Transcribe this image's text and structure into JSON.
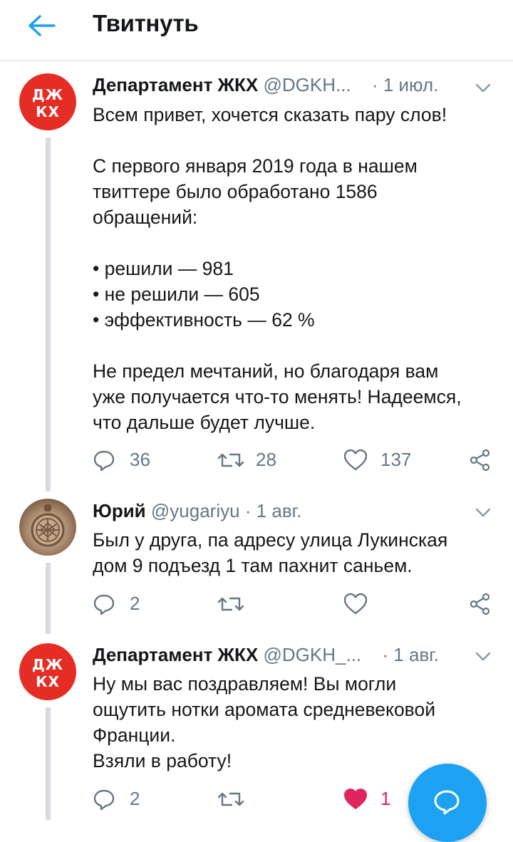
{
  "header": {
    "title": "Твитнуть"
  },
  "tweets": [
    {
      "avatar": {
        "line1": "ДЖ",
        "line2": "КХ"
      },
      "name": "Департамент ЖКХ",
      "handle": "@DGKH...",
      "sep": "·",
      "date": "1 июл.",
      "lines": [
        "Всем привет, хочется сказать пару слов!",
        "",
        "С первого января 2019 года в нашем",
        "твиттере было обработано 1586",
        "обращений:",
        "",
        "• решили — 981",
        "• не решили — 605",
        "• эффективность — 62 %",
        "",
        "Не предел мечтаний, но благодаря вам",
        "уже получается что-то менять! Надеемся,",
        "что дальше будет лучше."
      ],
      "replies": "36",
      "retweets": "28",
      "likes": "137",
      "liked": false
    },
    {
      "name": "Юрий",
      "handle": "@yugariyu",
      "sep": "·",
      "date": "1 авг.",
      "lines": [
        "Был у друга, па адресу улица Лукинская",
        "дом 9 подъезд 1 там пахнит саньем."
      ],
      "replies": "2",
      "retweets": "",
      "likes": "",
      "liked": false
    },
    {
      "avatar": {
        "line1": "ДЖ",
        "line2": "КХ"
      },
      "name": "Департамент ЖКХ",
      "handle": "@DGKH_...",
      "sep": "·",
      "date": "1 авг.",
      "lines": [
        "Ну мы вас поздравляем! Вы могли",
        "ощутить нотки аромата средневековой",
        "Франции.",
        "Взяли в работу!"
      ],
      "replies": "2",
      "retweets": "",
      "likes": "1",
      "liked": true
    }
  ],
  "icons": {
    "back": "arrow-left-icon",
    "reply": "reply-icon",
    "retweet": "retweet-icon",
    "like": "heart-icon",
    "share": "share-icon",
    "more": "chevron-down-icon",
    "compose": "compose-icon"
  },
  "colors": {
    "accent": "#1da1f2",
    "like": "#e0245e",
    "avatar_red": "#e62d25",
    "muted": "#657786"
  }
}
